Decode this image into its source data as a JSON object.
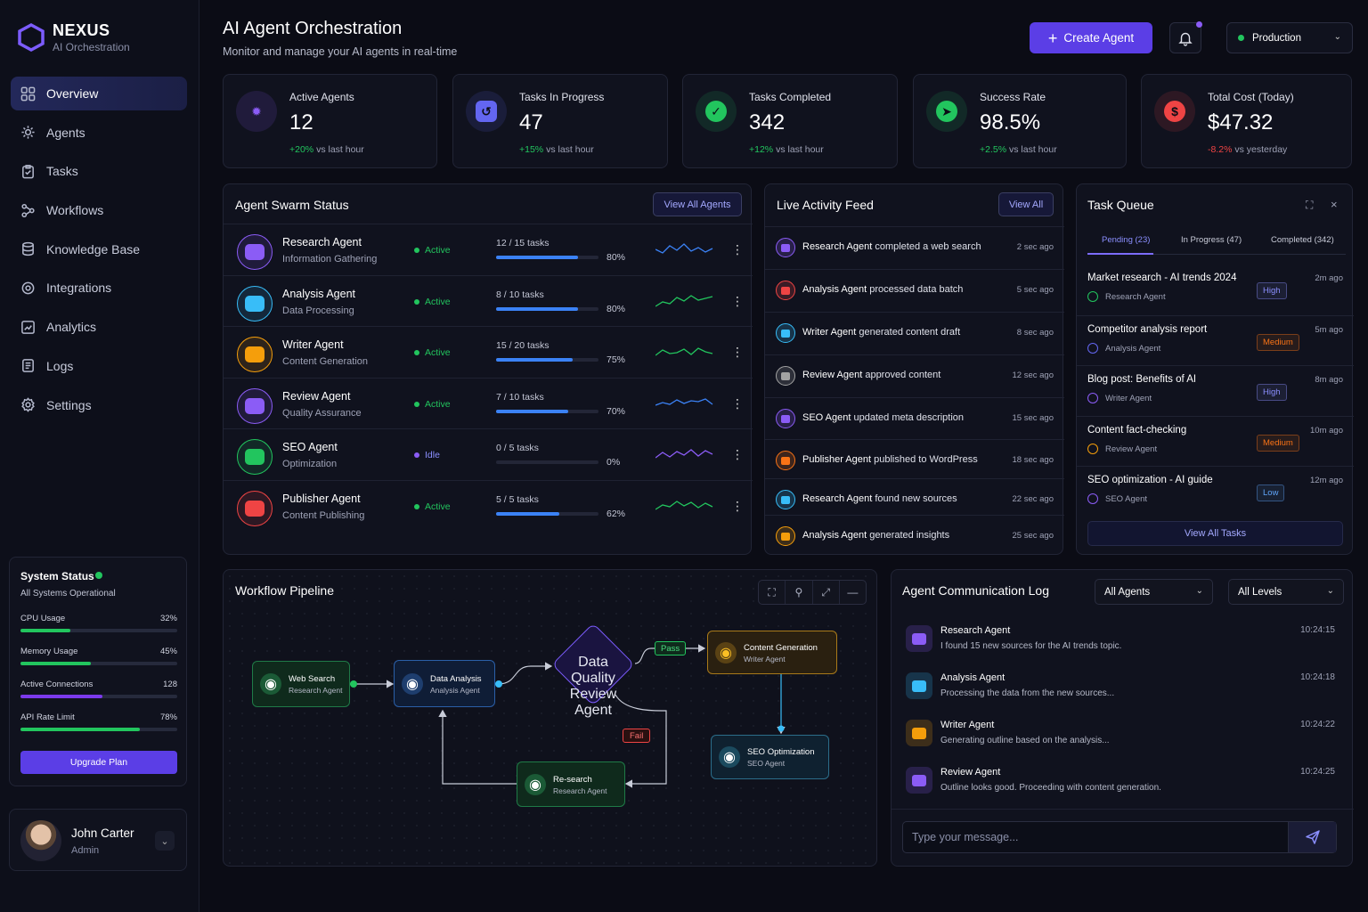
{
  "brand": {
    "name": "NEXUS",
    "subtitle": "AI Orchestration"
  },
  "nav": [
    {
      "label": "Overview",
      "icon": "grid-icon",
      "active": true
    },
    {
      "label": "Agents",
      "icon": "agents-gear-icon"
    },
    {
      "label": "Tasks",
      "icon": "clipboard-icon"
    },
    {
      "label": "Workflows",
      "icon": "workflow-icon"
    },
    {
      "label": "Knowledge Base",
      "icon": "database-icon"
    },
    {
      "label": "Integrations",
      "icon": "integrations-icon"
    },
    {
      "label": "Analytics",
      "icon": "analytics-icon"
    },
    {
      "label": "Logs",
      "icon": "logs-icon"
    },
    {
      "label": "Settings",
      "icon": "settings-icon"
    }
  ],
  "system": {
    "title": "System Status",
    "subtitle": "All Systems Operational",
    "meters": [
      {
        "label": "CPU Usage",
        "value": "32%",
        "fraction": 0.32,
        "color": "#22c55e"
      },
      {
        "label": "Memory Usage",
        "value": "45%",
        "fraction": 0.45,
        "color": "#22c55e"
      },
      {
        "label": "Active Connections",
        "value": "128",
        "fraction": 0.52,
        "color": "#7c3aed"
      },
      {
        "label": "API Rate Limit",
        "value": "78%",
        "fraction": 0.76,
        "color": "#22c55e"
      }
    ],
    "upgrade": "Upgrade Plan"
  },
  "user": {
    "name": "John Carter",
    "role": "Admin"
  },
  "header": {
    "title": "AI Agent Orchestration",
    "subtitle": "Monitor and manage your AI agents in real-time",
    "create": "Create Agent",
    "env": "Production"
  },
  "stats": [
    {
      "label": "Active Agents",
      "value": "12",
      "change": "+20%",
      "suffix": "vs last hour",
      "dir": "up",
      "color": "#8b5cf6"
    },
    {
      "label": "Tasks In Progress",
      "value": "47",
      "change": "+15%",
      "suffix": "vs last hour",
      "dir": "up",
      "color": "#6366f1"
    },
    {
      "label": "Tasks Completed",
      "value": "342",
      "change": "+12%",
      "suffix": "vs last hour",
      "dir": "up",
      "color": "#22c55e"
    },
    {
      "label": "Success Rate",
      "value": "98.5%",
      "change": "+2.5%",
      "suffix": "vs last hour",
      "dir": "up",
      "color": "#22c55e"
    },
    {
      "label": "Total Cost (Today)",
      "value": "$47.32",
      "change": "-8.2%",
      "suffix": "vs yesterday",
      "dir": "down",
      "color": "#ef4444"
    }
  ],
  "swarm": {
    "title": "Agent Swarm Status",
    "view_all": "View All Agents",
    "agents": [
      {
        "name": "Research Agent",
        "desc": "Information Gathering",
        "status": "Active",
        "tasks": "12 / 15 tasks",
        "pct": "80%",
        "fraction": 0.8,
        "color": "#8b5cf6",
        "spark": "#3b82f6"
      },
      {
        "name": "Analysis Agent",
        "desc": "Data Processing",
        "status": "Active",
        "tasks": "8 / 10 tasks",
        "pct": "80%",
        "fraction": 0.8,
        "color": "#38bdf8",
        "spark": "#22c55e"
      },
      {
        "name": "Writer Agent",
        "desc": "Content Generation",
        "status": "Active",
        "tasks": "15 / 20 tasks",
        "pct": "75%",
        "fraction": 0.75,
        "color": "#f59e0b",
        "spark": "#22c55e"
      },
      {
        "name": "Review Agent",
        "desc": "Quality Assurance",
        "status": "Active",
        "tasks": "7 / 10 tasks",
        "pct": "70%",
        "fraction": 0.7,
        "color": "#8b5cf6",
        "spark": "#3b82f6"
      },
      {
        "name": "SEO Agent",
        "desc": "Optimization",
        "status": "Idle",
        "tasks": "0 / 5 tasks",
        "pct": "0%",
        "fraction": 0,
        "color": "#22c55e",
        "spark": "#8b5cf6"
      },
      {
        "name": "Publisher Agent",
        "desc": "Content Publishing",
        "status": "Active",
        "tasks": "5 / 5 tasks",
        "pct": "62%",
        "fraction": 0.62,
        "color": "#ef4444",
        "spark": "#22c55e"
      }
    ]
  },
  "feed": {
    "title": "Live Activity Feed",
    "view_all": "View All",
    "items": [
      {
        "agent": "Research Agent",
        "text": "completed a web search",
        "time": "2 sec ago",
        "color": "#8b5cf6"
      },
      {
        "agent": "Analysis Agent",
        "text": "processed data batch",
        "time": "5 sec ago",
        "color": "#ef4444"
      },
      {
        "agent": "Writer Agent",
        "text": "generated content draft",
        "time": "8 sec ago",
        "color": "#38bdf8"
      },
      {
        "agent": "Review Agent",
        "text": "approved content",
        "time": "12 sec ago",
        "color": "#a3a3a3"
      },
      {
        "agent": "SEO Agent",
        "text": "updated meta description",
        "time": "15 sec ago",
        "color": "#8b5cf6"
      },
      {
        "agent": "Publisher Agent",
        "text": "published to WordPress",
        "time": "18 sec ago",
        "color": "#f97316"
      },
      {
        "agent": "Research Agent",
        "text": "found new sources",
        "time": "22 sec ago",
        "color": "#38bdf8"
      },
      {
        "agent": "Analysis Agent",
        "text": "generated insights",
        "time": "25 sec ago",
        "color": "#f59e0b"
      }
    ]
  },
  "queue": {
    "title": "Task Queue",
    "tabs": [
      "Pending (23)",
      "In Progress (47)",
      "Completed (342)"
    ],
    "items": [
      {
        "title": "Market research - AI trends 2024",
        "agent": "Research Agent",
        "priority": "High",
        "time": "2m ago",
        "pcolor": "#8b8fff",
        "icolor": "#22c55e"
      },
      {
        "title": "Competitor analysis report",
        "agent": "Analysis Agent",
        "priority": "Medium",
        "time": "5m ago",
        "pcolor": "#f97316",
        "icolor": "#6366f1"
      },
      {
        "title": "Blog post: Benefits of AI",
        "agent": "Writer Agent",
        "priority": "High",
        "time": "8m ago",
        "pcolor": "#8b8fff",
        "icolor": "#8b5cf6"
      },
      {
        "title": "Content fact-checking",
        "agent": "Review Agent",
        "priority": "Medium",
        "time": "10m ago",
        "pcolor": "#f97316",
        "icolor": "#f59e0b"
      },
      {
        "title": "SEO optimization - AI guide",
        "agent": "SEO Agent",
        "priority": "Low",
        "time": "12m ago",
        "pcolor": "#60a5fa",
        "icolor": "#8b5cf6"
      }
    ],
    "view_all": "View All Tasks"
  },
  "pipeline": {
    "title": "Workflow Pipeline",
    "nodes": [
      {
        "title": "Web Search",
        "agent": "Research Agent"
      },
      {
        "title": "Data Analysis",
        "agent": "Analysis Agent"
      },
      {
        "title": "Data Quality",
        "agent": "Review Agent"
      },
      {
        "title": "Content Generation",
        "agent": "Writer Agent"
      },
      {
        "title": "SEO Optimization",
        "agent": "SEO Agent"
      },
      {
        "title": "Re-search",
        "agent": "Research Agent"
      }
    ],
    "pass": "Pass",
    "fail": "Fail"
  },
  "comm": {
    "title": "Agent Communication Log",
    "filter_agents": "All Agents",
    "filter_levels": "All Levels",
    "messages": [
      {
        "agent": "Research Agent",
        "text": "I found 15 new sources for the AI trends topic.",
        "time": "10:24:15",
        "color": "#8b5cf6"
      },
      {
        "agent": "Analysis Agent",
        "text": "Processing the data from the new sources...",
        "time": "10:24:18",
        "color": "#38bdf8"
      },
      {
        "agent": "Writer Agent",
        "text": "Generating outline based on the analysis...",
        "time": "10:24:22",
        "color": "#f59e0b"
      },
      {
        "agent": "Review Agent",
        "text": "Outline looks good. Proceeding with content generation.",
        "time": "10:24:25",
        "color": "#8b5cf6"
      }
    ],
    "placeholder": "Type your message..."
  }
}
